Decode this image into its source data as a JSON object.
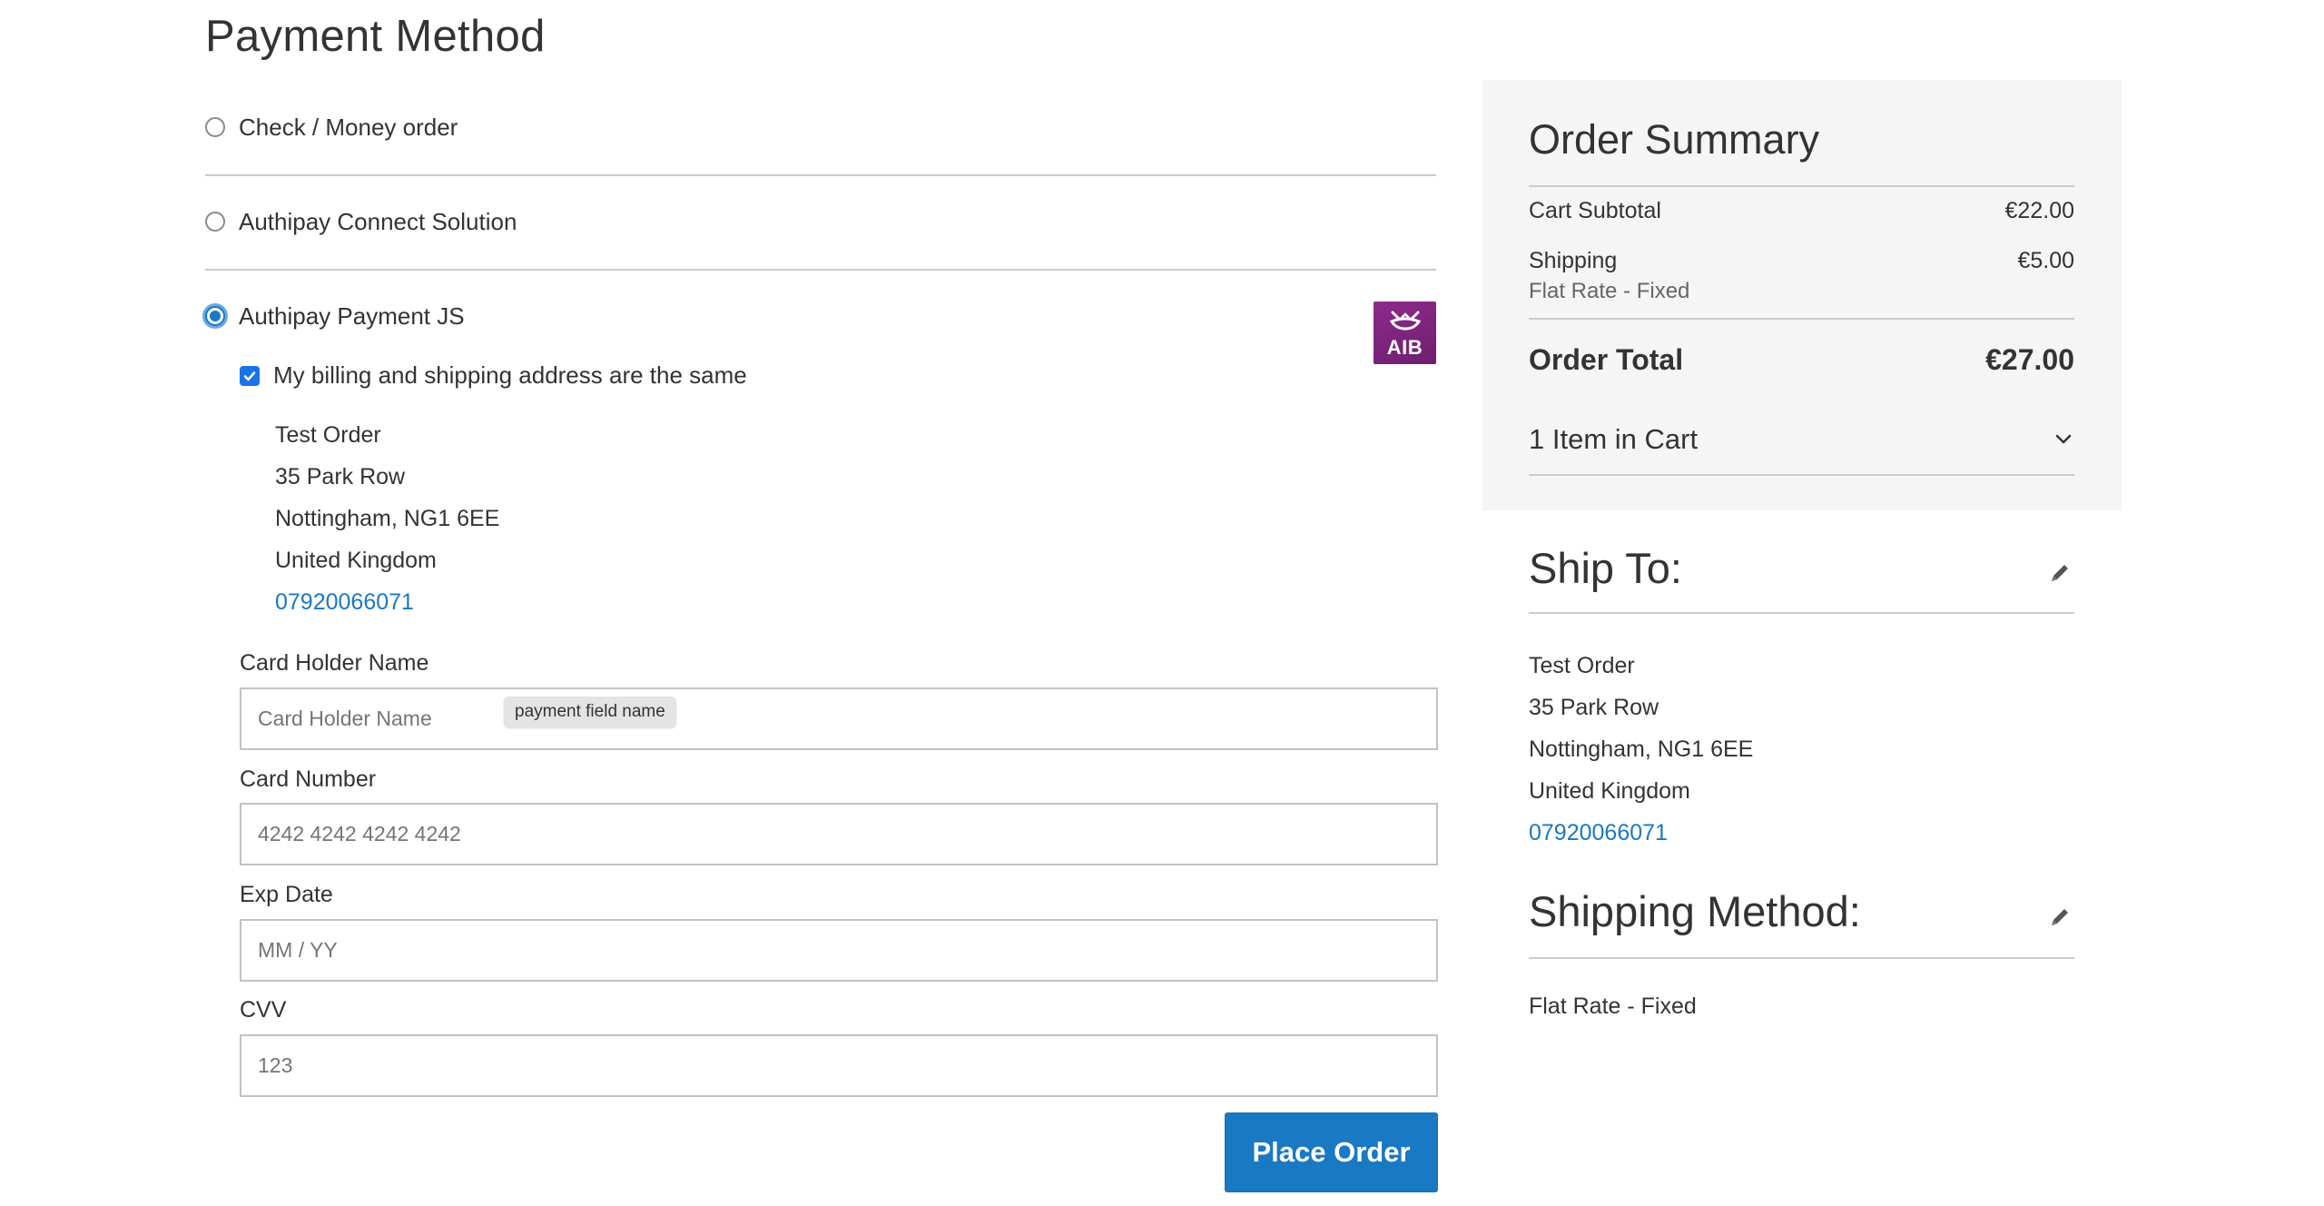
{
  "page_title": "Payment Method",
  "payment_methods": [
    {
      "label": "Check / Money order",
      "selected": false
    },
    {
      "label": "Authipay Connect Solution",
      "selected": false
    },
    {
      "label": "Authipay Payment JS",
      "selected": true
    }
  ],
  "aib_logo_text": "AIB",
  "billing_same": {
    "label": "My billing and shipping address are the same",
    "checked": true
  },
  "billing_address": {
    "name": "Test Order",
    "street": "35 Park Row",
    "city": "Nottingham, NG1 6EE",
    "country": "United Kingdom",
    "phone": "07920066071"
  },
  "card_form": {
    "holder_label": "Card Holder Name",
    "holder_placeholder": "Card Holder Name",
    "tooltip": "payment field name",
    "number_label": "Card Number",
    "number_placeholder": "4242 4242 4242 4242",
    "exp_label": "Exp Date",
    "exp_placeholder": "MM / YY",
    "cvv_label": "CVV",
    "cvv_placeholder": "123"
  },
  "place_order_label": "Place Order",
  "order_summary": {
    "title": "Order Summary",
    "subtotal_label": "Cart Subtotal",
    "subtotal_value": "€22.00",
    "shipping_label": "Shipping",
    "shipping_value": "€5.00",
    "shipping_method": "Flat Rate - Fixed",
    "total_label": "Order Total",
    "total_value": "€27.00",
    "items_label": "1 Item in Cart"
  },
  "ship_to": {
    "title": "Ship To:",
    "name": "Test Order",
    "street": "35 Park Row",
    "city": "Nottingham, NG1 6EE",
    "country": "United Kingdom",
    "phone": "07920066071"
  },
  "shipping_method": {
    "title": "Shipping Method:",
    "value": "Flat Rate - Fixed"
  },
  "colors": {
    "accent": "#1979c3",
    "aib": "#7b2479",
    "summary_bg": "#f5f5f5"
  }
}
